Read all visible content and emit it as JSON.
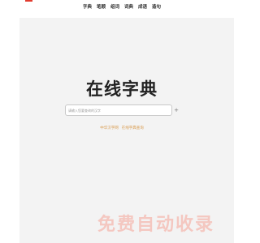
{
  "nav": {
    "items": [
      "字典",
      "笔顺",
      "组词",
      "词典",
      "成语",
      "造句"
    ]
  },
  "hero": {
    "title": "在线字典"
  },
  "search": {
    "placeholder": "请输入您要查询的汉字",
    "button_icon": "+"
  },
  "links": [
    "中华汉字网",
    "在线字典查询"
  ],
  "watermark": {
    "text": "免费自动收录"
  },
  "colors": {
    "accent": "#e23b2e",
    "link": "#d89a4c",
    "panel": "#f3f3f3"
  }
}
